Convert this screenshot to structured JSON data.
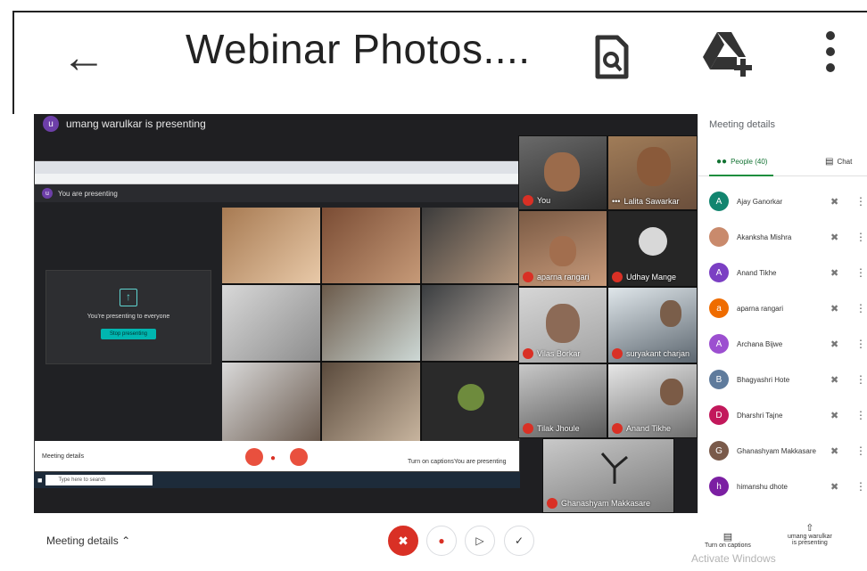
{
  "appbar": {
    "title": "Webinar Photos....",
    "icons": [
      "back-arrow-icon",
      "find-in-document-icon",
      "add-to-drive-icon",
      "more-vert-icon"
    ]
  },
  "meet": {
    "presenter_initial": "u",
    "presenter_text": "umang warulkar is presenting",
    "shared": {
      "bar_initial": "u",
      "bar_text": "You are presenting",
      "card_text": "You're presenting to everyone",
      "card_button": "Stop presenting",
      "inner_meeting_details": "Meeting details",
      "inner_captions": "Turn on captions",
      "inner_presenting": "You are presenting",
      "taskbar_search": "Type here to search"
    },
    "tiles": [
      {
        "name": "You"
      },
      {
        "name": "Lalita Sawarkar"
      },
      {
        "name": "aparna rangari"
      },
      {
        "name": "Udhay Mange"
      },
      {
        "name": "Vilas Borkar"
      },
      {
        "name": "suryakant charjan"
      },
      {
        "name": "Tilak Jhoule"
      },
      {
        "name": "Anand Tikhe"
      },
      {
        "name": "Ghanashyam Makkasare"
      }
    ]
  },
  "side": {
    "title": "Meeting details",
    "tab_people": "People (40)",
    "tab_chat": "Chat",
    "people": [
      {
        "initial": "A",
        "name": "Ajay Ganorkar",
        "color": "#12856f"
      },
      {
        "initial": "",
        "name": "Akanksha Mishra",
        "color": "#c98a6c"
      },
      {
        "initial": "A",
        "name": "Anand Tikhe",
        "color": "#7b3fc3"
      },
      {
        "initial": "a",
        "name": "aparna rangari",
        "color": "#ef6c00"
      },
      {
        "initial": "A",
        "name": "Archana Bijwe",
        "color": "#9c4fd0"
      },
      {
        "initial": "B",
        "name": "Bhagyashri Hote",
        "color": "#5f7b9c"
      },
      {
        "initial": "D",
        "name": "Dharshri Tajne",
        "color": "#c2185b"
      },
      {
        "initial": "G",
        "name": "Ghanashyam Makkasare",
        "color": "#7a5a4a"
      },
      {
        "initial": "h",
        "name": "himanshu dhote",
        "color": "#7b1fa2"
      }
    ]
  },
  "bottom": {
    "meeting_details": "Meeting details",
    "captions": "Turn on captions",
    "presenting_line1": "umang warulkar",
    "presenting_line2": "is presenting",
    "watermark": "Activate Windows"
  }
}
